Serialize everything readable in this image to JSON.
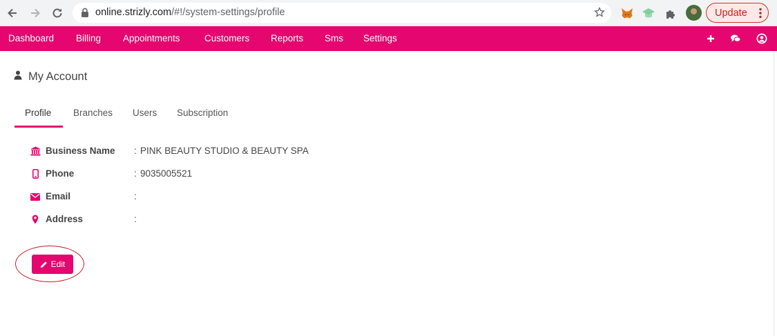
{
  "browser": {
    "url_host": "online.strizly.com",
    "url_path": "/#!/system-settings/profile",
    "update_label": "Update",
    "icons": [
      "back-arrow-icon",
      "forward-arrow-icon",
      "reload-icon",
      "lock-icon",
      "star-icon",
      "metamask-fox-icon",
      "graduation-cap-icon",
      "puzzle-extensions-icon",
      "profile-avatar",
      "more-vert-icon"
    ]
  },
  "navbar": {
    "items": [
      "Dashboard",
      "Billing",
      "Appointments",
      "Customers",
      "Reports",
      "Sms",
      "Settings"
    ],
    "right_icons": [
      "plus-icon",
      "chat-icon",
      "user-circle-icon"
    ],
    "color": "#e5066f"
  },
  "page": {
    "title": "My Account",
    "title_icon": "user-icon"
  },
  "tabs": {
    "items": [
      "Profile",
      "Branches",
      "Users",
      "Subscription"
    ],
    "active": "Profile"
  },
  "profile": {
    "separator": ":",
    "rows": [
      {
        "label": "Business Name",
        "value": "PINK BEAUTY STUDIO & BEAUTY SPA",
        "icon": "bank-icon"
      },
      {
        "label": "Phone",
        "value": "9035005521",
        "icon": "mobile-phone-icon"
      },
      {
        "label": "Email",
        "value": "",
        "icon": "envelope-icon"
      },
      {
        "label": "Address",
        "value": "",
        "icon": "map-marker-icon"
      }
    ]
  },
  "actions": {
    "edit_label": "Edit",
    "edit_icon": "pencil-icon"
  },
  "colors": {
    "accent": "#e5066f",
    "highlight_circle": "#c71b2b"
  }
}
